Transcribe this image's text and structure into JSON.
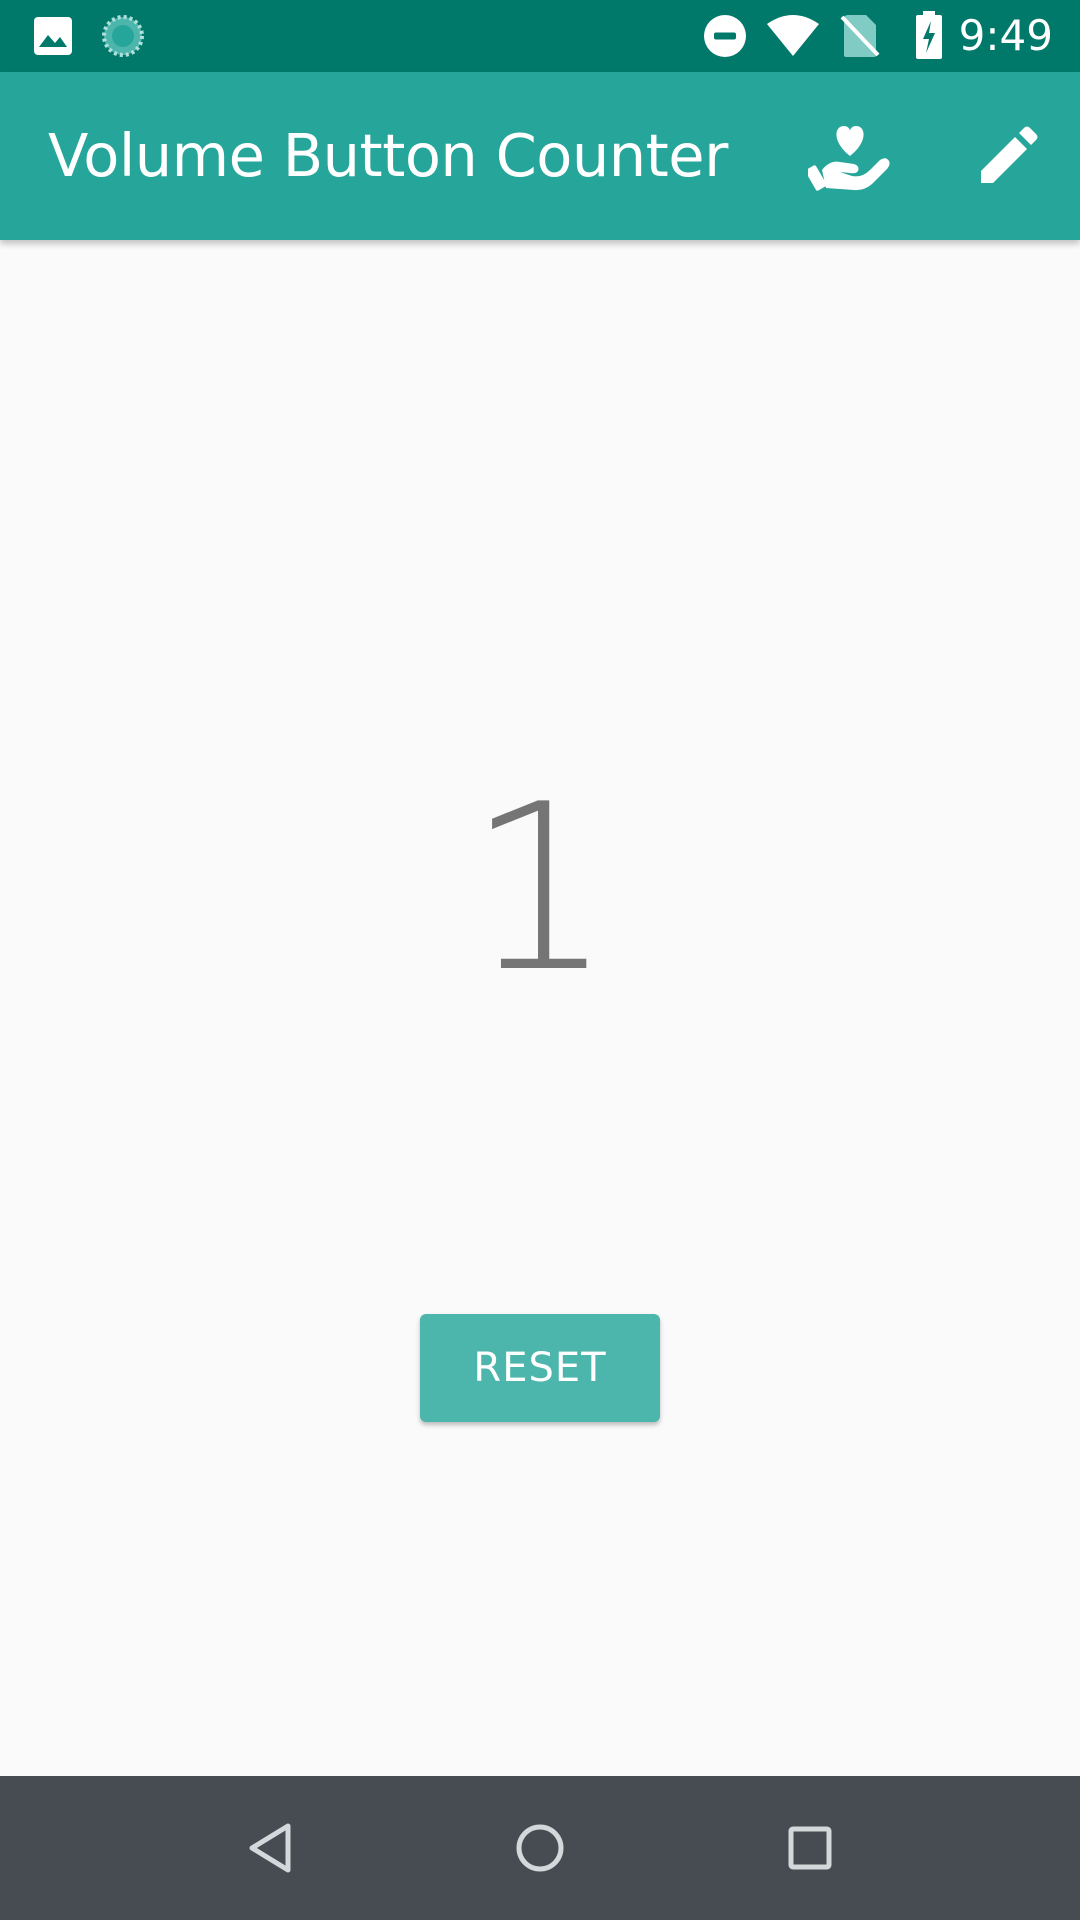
{
  "status_bar": {
    "time": "9:49",
    "left_icons": [
      "image-notification-icon",
      "sync-progress-icon"
    ],
    "right_icons": [
      "do-not-disturb-icon",
      "wifi-icon",
      "no-sim-icon",
      "battery-charging-icon"
    ],
    "background": "#00796b"
  },
  "app_bar": {
    "title": "Volume Button Counter",
    "actions": [
      "donate-heart-hand-icon",
      "edit-pencil-icon"
    ],
    "background": "#26a69a"
  },
  "counter": {
    "value": "1",
    "color": "#757575"
  },
  "reset": {
    "label": "RESET",
    "background": "#4db6ac"
  },
  "nav_bar": {
    "buttons": [
      "back-icon",
      "home-icon",
      "recents-icon"
    ],
    "background": "#474c52"
  }
}
